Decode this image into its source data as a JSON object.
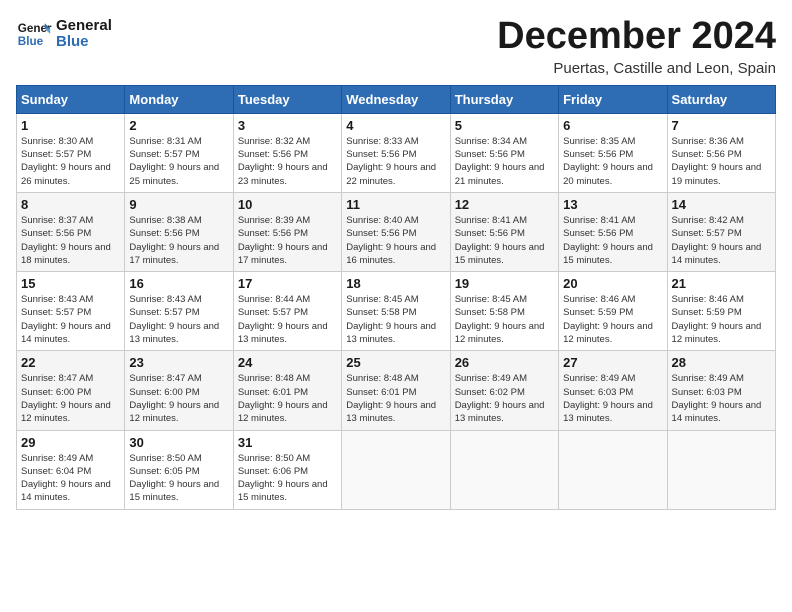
{
  "header": {
    "logo_line1": "General",
    "logo_line2": "Blue",
    "month_title": "December 2024",
    "location": "Puertas, Castille and Leon, Spain"
  },
  "weekdays": [
    "Sunday",
    "Monday",
    "Tuesday",
    "Wednesday",
    "Thursday",
    "Friday",
    "Saturday"
  ],
  "weeks": [
    [
      {
        "day": "1",
        "sunrise": "8:30 AM",
        "sunset": "5:57 PM",
        "daylight": "9 hours and 26 minutes."
      },
      {
        "day": "2",
        "sunrise": "8:31 AM",
        "sunset": "5:57 PM",
        "daylight": "9 hours and 25 minutes."
      },
      {
        "day": "3",
        "sunrise": "8:32 AM",
        "sunset": "5:56 PM",
        "daylight": "9 hours and 23 minutes."
      },
      {
        "day": "4",
        "sunrise": "8:33 AM",
        "sunset": "5:56 PM",
        "daylight": "9 hours and 22 minutes."
      },
      {
        "day": "5",
        "sunrise": "8:34 AM",
        "sunset": "5:56 PM",
        "daylight": "9 hours and 21 minutes."
      },
      {
        "day": "6",
        "sunrise": "8:35 AM",
        "sunset": "5:56 PM",
        "daylight": "9 hours and 20 minutes."
      },
      {
        "day": "7",
        "sunrise": "8:36 AM",
        "sunset": "5:56 PM",
        "daylight": "9 hours and 19 minutes."
      }
    ],
    [
      {
        "day": "8",
        "sunrise": "8:37 AM",
        "sunset": "5:56 PM",
        "daylight": "9 hours and 18 minutes."
      },
      {
        "day": "9",
        "sunrise": "8:38 AM",
        "sunset": "5:56 PM",
        "daylight": "9 hours and 17 minutes."
      },
      {
        "day": "10",
        "sunrise": "8:39 AM",
        "sunset": "5:56 PM",
        "daylight": "9 hours and 17 minutes."
      },
      {
        "day": "11",
        "sunrise": "8:40 AM",
        "sunset": "5:56 PM",
        "daylight": "9 hours and 16 minutes."
      },
      {
        "day": "12",
        "sunrise": "8:41 AM",
        "sunset": "5:56 PM",
        "daylight": "9 hours and 15 minutes."
      },
      {
        "day": "13",
        "sunrise": "8:41 AM",
        "sunset": "5:56 PM",
        "daylight": "9 hours and 15 minutes."
      },
      {
        "day": "14",
        "sunrise": "8:42 AM",
        "sunset": "5:57 PM",
        "daylight": "9 hours and 14 minutes."
      }
    ],
    [
      {
        "day": "15",
        "sunrise": "8:43 AM",
        "sunset": "5:57 PM",
        "daylight": "9 hours and 14 minutes."
      },
      {
        "day": "16",
        "sunrise": "8:43 AM",
        "sunset": "5:57 PM",
        "daylight": "9 hours and 13 minutes."
      },
      {
        "day": "17",
        "sunrise": "8:44 AM",
        "sunset": "5:57 PM",
        "daylight": "9 hours and 13 minutes."
      },
      {
        "day": "18",
        "sunrise": "8:45 AM",
        "sunset": "5:58 PM",
        "daylight": "9 hours and 13 minutes."
      },
      {
        "day": "19",
        "sunrise": "8:45 AM",
        "sunset": "5:58 PM",
        "daylight": "9 hours and 12 minutes."
      },
      {
        "day": "20",
        "sunrise": "8:46 AM",
        "sunset": "5:59 PM",
        "daylight": "9 hours and 12 minutes."
      },
      {
        "day": "21",
        "sunrise": "8:46 AM",
        "sunset": "5:59 PM",
        "daylight": "9 hours and 12 minutes."
      }
    ],
    [
      {
        "day": "22",
        "sunrise": "8:47 AM",
        "sunset": "6:00 PM",
        "daylight": "9 hours and 12 minutes."
      },
      {
        "day": "23",
        "sunrise": "8:47 AM",
        "sunset": "6:00 PM",
        "daylight": "9 hours and 12 minutes."
      },
      {
        "day": "24",
        "sunrise": "8:48 AM",
        "sunset": "6:01 PM",
        "daylight": "9 hours and 12 minutes."
      },
      {
        "day": "25",
        "sunrise": "8:48 AM",
        "sunset": "6:01 PM",
        "daylight": "9 hours and 13 minutes."
      },
      {
        "day": "26",
        "sunrise": "8:49 AM",
        "sunset": "6:02 PM",
        "daylight": "9 hours and 13 minutes."
      },
      {
        "day": "27",
        "sunrise": "8:49 AM",
        "sunset": "6:03 PM",
        "daylight": "9 hours and 13 minutes."
      },
      {
        "day": "28",
        "sunrise": "8:49 AM",
        "sunset": "6:03 PM",
        "daylight": "9 hours and 14 minutes."
      }
    ],
    [
      {
        "day": "29",
        "sunrise": "8:49 AM",
        "sunset": "6:04 PM",
        "daylight": "9 hours and 14 minutes."
      },
      {
        "day": "30",
        "sunrise": "8:50 AM",
        "sunset": "6:05 PM",
        "daylight": "9 hours and 15 minutes."
      },
      {
        "day": "31",
        "sunrise": "8:50 AM",
        "sunset": "6:06 PM",
        "daylight": "9 hours and 15 minutes."
      },
      null,
      null,
      null,
      null
    ]
  ],
  "labels": {
    "sunrise": "Sunrise:",
    "sunset": "Sunset:",
    "daylight": "Daylight:"
  }
}
